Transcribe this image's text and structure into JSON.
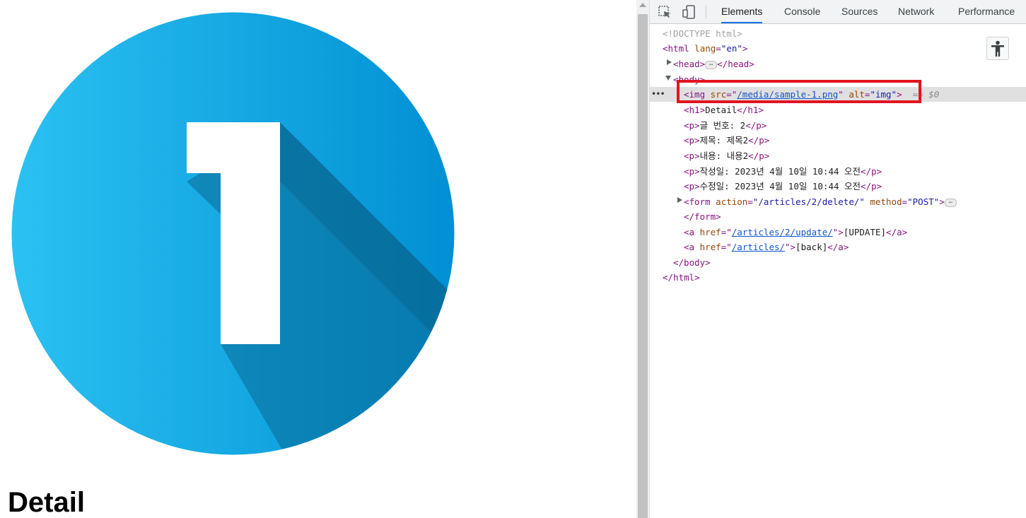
{
  "page": {
    "title": "Detail",
    "image_alt": "img",
    "image_number": "1"
  },
  "devtools": {
    "tabs": [
      "Elements",
      "Console",
      "Sources",
      "Network",
      "Performance"
    ],
    "active_tab": "Elements",
    "lines": {
      "doctype": "<!DOCTYPE html>",
      "html_open_tag": "<html",
      "html_lang_attr": "lang",
      "html_lang_val": "\"en\"",
      "head_open": "<head>",
      "head_close": "</head>",
      "body_open": "<body>",
      "img_tag": "<img",
      "img_src_attr": "src",
      "img_src_val": "/media/sample-1.png",
      "img_alt_attr": "alt",
      "img_alt_val": "\"img\"",
      "eq_dollar": "== $0",
      "h1_open": "<h1>",
      "h1_text": "Detail",
      "h1_close": "</h1>",
      "p_open": "<p>",
      "p_close": "</p>",
      "p1": "글 번호: 2",
      "p2": "제목: 제목2",
      "p3": "내용: 내용2",
      "p4": "작성일: 2023년 4월 10일 10:44 오전",
      "p5": "수정일: 2023년 4월 10일 10:44 오전",
      "form_tag": "<form",
      "form_action_attr": "action",
      "form_action_val": "\"/articles/2/delete/\"",
      "form_method_attr": "method",
      "form_method_val": "\"POST\"",
      "form_close": "</form>",
      "a_tag": "<a",
      "a_href_attr": "href",
      "a1_href": "/articles/2/update/",
      "a1_text": "[UPDATE]",
      "a2_href": "/articles/",
      "a2_text": "[back]",
      "a_close": "</a>",
      "body_close": "</body>",
      "html_close": "</html>"
    }
  },
  "colors": {
    "circle_light": "#2bc1f2",
    "circle_dark": "#0190d3",
    "highlight": "#e0151f",
    "tab_active_underline": "#1a73e8"
  },
  "icons": [
    "inspect-icon",
    "device-toggle-icon",
    "accessibility-icon",
    "ellipsis-icon"
  ]
}
